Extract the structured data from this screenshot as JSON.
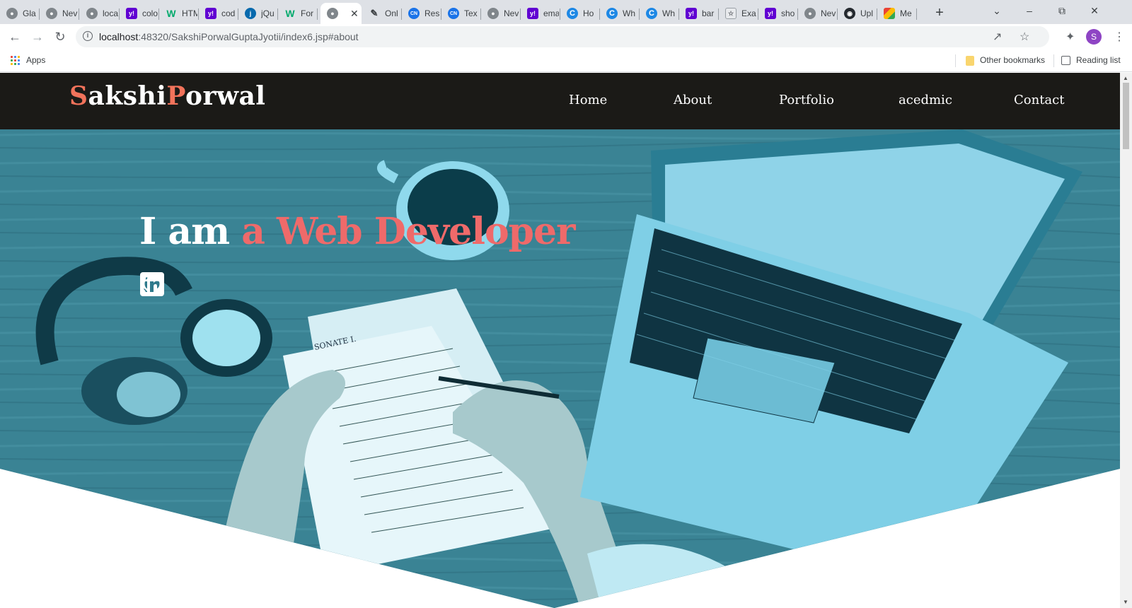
{
  "browser": {
    "tabs": [
      {
        "title": "Gla",
        "icon": "globe-icon",
        "kind": "globe"
      },
      {
        "title": "Nev",
        "icon": "globe-icon",
        "kind": "globe"
      },
      {
        "title": "loca",
        "icon": "globe-icon",
        "kind": "globe"
      },
      {
        "title": "colo",
        "icon": "yahoo-icon",
        "kind": "yahoo"
      },
      {
        "title": "HTM",
        "icon": "w3schools-icon",
        "kind": "w3"
      },
      {
        "title": "cod",
        "icon": "yahoo-icon",
        "kind": "yahoo"
      },
      {
        "title": "jQu",
        "icon": "jquery-icon",
        "kind": "jq"
      },
      {
        "title": "For",
        "icon": "w3schools-icon",
        "kind": "w3"
      },
      {
        "title": "",
        "icon": "globe-icon",
        "kind": "globe",
        "active": true
      },
      {
        "title": "Onl",
        "icon": "pen-icon",
        "kind": "pen"
      },
      {
        "title": "Res",
        "icon": "codingninjas-icon",
        "kind": "cn"
      },
      {
        "title": "Tex",
        "icon": "codingninjas-icon",
        "kind": "cn"
      },
      {
        "title": "Nev",
        "icon": "globe-icon",
        "kind": "globe"
      },
      {
        "title": "ema",
        "icon": "yahoo-icon",
        "kind": "yahoo"
      },
      {
        "title": "Ho",
        "icon": "c-logo-icon",
        "kind": "c"
      },
      {
        "title": "Wh",
        "icon": "c-logo-icon",
        "kind": "c"
      },
      {
        "title": "Wh",
        "icon": "c-logo-icon",
        "kind": "c"
      },
      {
        "title": "bar",
        "icon": "yahoo-icon",
        "kind": "yahoo"
      },
      {
        "title": "Exa",
        "icon": "example-icon",
        "kind": "ex"
      },
      {
        "title": "sho",
        "icon": "yahoo-icon",
        "kind": "yahoo"
      },
      {
        "title": "Nev",
        "icon": "globe-icon",
        "kind": "globe"
      },
      {
        "title": "Upl",
        "icon": "github-icon",
        "kind": "gh"
      },
      {
        "title": "Me",
        "icon": "meet-icon",
        "kind": "me"
      }
    ],
    "address": {
      "host": "localhost",
      "path": ":48320/SakshiPorwalGuptaJyotii/index6.jsp#about"
    },
    "profile_initial": "S",
    "bookmarks": {
      "apps": "Apps",
      "other": "Other bookmarks",
      "reading_list": "Reading list"
    }
  },
  "site": {
    "logo": {
      "first_initial": "S",
      "first_rest": "akshi",
      "last_initial": "P",
      "last_rest": "orwal"
    },
    "nav": [
      "Home",
      "About",
      "Portfolio",
      "acedmic",
      "Contact"
    ],
    "hero": {
      "prefix": "I am ",
      "role": "a Web Developer"
    },
    "socials": [
      "instagram-icon",
      "twitter-icon",
      "linkedin-icon",
      "github-icon"
    ],
    "colors": {
      "accent": "#f2735b",
      "role_text": "#ef6a6a",
      "header_bg": "#1b1a17",
      "hero_tint": "#3d8b9e"
    }
  }
}
